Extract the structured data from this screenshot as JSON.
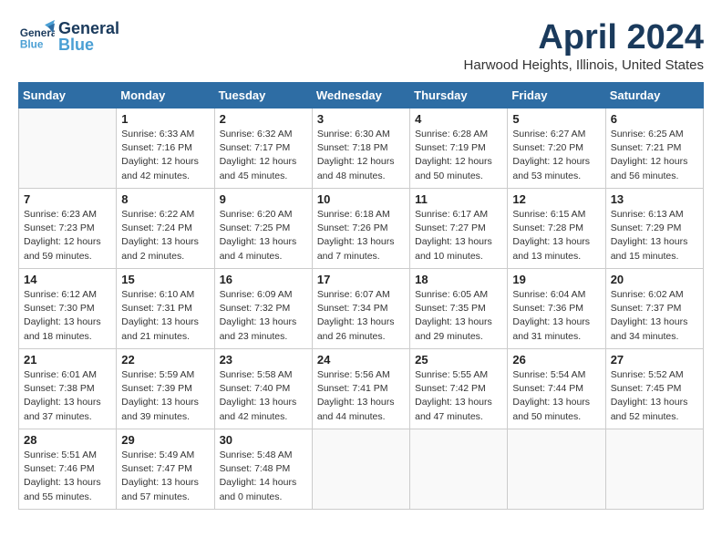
{
  "header": {
    "logo_general": "General",
    "logo_blue": "Blue",
    "month": "April 2024",
    "location": "Harwood Heights, Illinois, United States"
  },
  "days_of_week": [
    "Sunday",
    "Monday",
    "Tuesday",
    "Wednesday",
    "Thursday",
    "Friday",
    "Saturday"
  ],
  "weeks": [
    [
      {
        "day": "",
        "sunrise": "",
        "sunset": "",
        "daylight": ""
      },
      {
        "day": "1",
        "sunrise": "Sunrise: 6:33 AM",
        "sunset": "Sunset: 7:16 PM",
        "daylight": "Daylight: 12 hours and 42 minutes."
      },
      {
        "day": "2",
        "sunrise": "Sunrise: 6:32 AM",
        "sunset": "Sunset: 7:17 PM",
        "daylight": "Daylight: 12 hours and 45 minutes."
      },
      {
        "day": "3",
        "sunrise": "Sunrise: 6:30 AM",
        "sunset": "Sunset: 7:18 PM",
        "daylight": "Daylight: 12 hours and 48 minutes."
      },
      {
        "day": "4",
        "sunrise": "Sunrise: 6:28 AM",
        "sunset": "Sunset: 7:19 PM",
        "daylight": "Daylight: 12 hours and 50 minutes."
      },
      {
        "day": "5",
        "sunrise": "Sunrise: 6:27 AM",
        "sunset": "Sunset: 7:20 PM",
        "daylight": "Daylight: 12 hours and 53 minutes."
      },
      {
        "day": "6",
        "sunrise": "Sunrise: 6:25 AM",
        "sunset": "Sunset: 7:21 PM",
        "daylight": "Daylight: 12 hours and 56 minutes."
      }
    ],
    [
      {
        "day": "7",
        "sunrise": "Sunrise: 6:23 AM",
        "sunset": "Sunset: 7:23 PM",
        "daylight": "Daylight: 12 hours and 59 minutes."
      },
      {
        "day": "8",
        "sunrise": "Sunrise: 6:22 AM",
        "sunset": "Sunset: 7:24 PM",
        "daylight": "Daylight: 13 hours and 2 minutes."
      },
      {
        "day": "9",
        "sunrise": "Sunrise: 6:20 AM",
        "sunset": "Sunset: 7:25 PM",
        "daylight": "Daylight: 13 hours and 4 minutes."
      },
      {
        "day": "10",
        "sunrise": "Sunrise: 6:18 AM",
        "sunset": "Sunset: 7:26 PM",
        "daylight": "Daylight: 13 hours and 7 minutes."
      },
      {
        "day": "11",
        "sunrise": "Sunrise: 6:17 AM",
        "sunset": "Sunset: 7:27 PM",
        "daylight": "Daylight: 13 hours and 10 minutes."
      },
      {
        "day": "12",
        "sunrise": "Sunrise: 6:15 AM",
        "sunset": "Sunset: 7:28 PM",
        "daylight": "Daylight: 13 hours and 13 minutes."
      },
      {
        "day": "13",
        "sunrise": "Sunrise: 6:13 AM",
        "sunset": "Sunset: 7:29 PM",
        "daylight": "Daylight: 13 hours and 15 minutes."
      }
    ],
    [
      {
        "day": "14",
        "sunrise": "Sunrise: 6:12 AM",
        "sunset": "Sunset: 7:30 PM",
        "daylight": "Daylight: 13 hours and 18 minutes."
      },
      {
        "day": "15",
        "sunrise": "Sunrise: 6:10 AM",
        "sunset": "Sunset: 7:31 PM",
        "daylight": "Daylight: 13 hours and 21 minutes."
      },
      {
        "day": "16",
        "sunrise": "Sunrise: 6:09 AM",
        "sunset": "Sunset: 7:32 PM",
        "daylight": "Daylight: 13 hours and 23 minutes."
      },
      {
        "day": "17",
        "sunrise": "Sunrise: 6:07 AM",
        "sunset": "Sunset: 7:34 PM",
        "daylight": "Daylight: 13 hours and 26 minutes."
      },
      {
        "day": "18",
        "sunrise": "Sunrise: 6:05 AM",
        "sunset": "Sunset: 7:35 PM",
        "daylight": "Daylight: 13 hours and 29 minutes."
      },
      {
        "day": "19",
        "sunrise": "Sunrise: 6:04 AM",
        "sunset": "Sunset: 7:36 PM",
        "daylight": "Daylight: 13 hours and 31 minutes."
      },
      {
        "day": "20",
        "sunrise": "Sunrise: 6:02 AM",
        "sunset": "Sunset: 7:37 PM",
        "daylight": "Daylight: 13 hours and 34 minutes."
      }
    ],
    [
      {
        "day": "21",
        "sunrise": "Sunrise: 6:01 AM",
        "sunset": "Sunset: 7:38 PM",
        "daylight": "Daylight: 13 hours and 37 minutes."
      },
      {
        "day": "22",
        "sunrise": "Sunrise: 5:59 AM",
        "sunset": "Sunset: 7:39 PM",
        "daylight": "Daylight: 13 hours and 39 minutes."
      },
      {
        "day": "23",
        "sunrise": "Sunrise: 5:58 AM",
        "sunset": "Sunset: 7:40 PM",
        "daylight": "Daylight: 13 hours and 42 minutes."
      },
      {
        "day": "24",
        "sunrise": "Sunrise: 5:56 AM",
        "sunset": "Sunset: 7:41 PM",
        "daylight": "Daylight: 13 hours and 44 minutes."
      },
      {
        "day": "25",
        "sunrise": "Sunrise: 5:55 AM",
        "sunset": "Sunset: 7:42 PM",
        "daylight": "Daylight: 13 hours and 47 minutes."
      },
      {
        "day": "26",
        "sunrise": "Sunrise: 5:54 AM",
        "sunset": "Sunset: 7:44 PM",
        "daylight": "Daylight: 13 hours and 50 minutes."
      },
      {
        "day": "27",
        "sunrise": "Sunrise: 5:52 AM",
        "sunset": "Sunset: 7:45 PM",
        "daylight": "Daylight: 13 hours and 52 minutes."
      }
    ],
    [
      {
        "day": "28",
        "sunrise": "Sunrise: 5:51 AM",
        "sunset": "Sunset: 7:46 PM",
        "daylight": "Daylight: 13 hours and 55 minutes."
      },
      {
        "day": "29",
        "sunrise": "Sunrise: 5:49 AM",
        "sunset": "Sunset: 7:47 PM",
        "daylight": "Daylight: 13 hours and 57 minutes."
      },
      {
        "day": "30",
        "sunrise": "Sunrise: 5:48 AM",
        "sunset": "Sunset: 7:48 PM",
        "daylight": "Daylight: 14 hours and 0 minutes."
      },
      {
        "day": "",
        "sunrise": "",
        "sunset": "",
        "daylight": ""
      },
      {
        "day": "",
        "sunrise": "",
        "sunset": "",
        "daylight": ""
      },
      {
        "day": "",
        "sunrise": "",
        "sunset": "",
        "daylight": ""
      },
      {
        "day": "",
        "sunrise": "",
        "sunset": "",
        "daylight": ""
      }
    ]
  ]
}
